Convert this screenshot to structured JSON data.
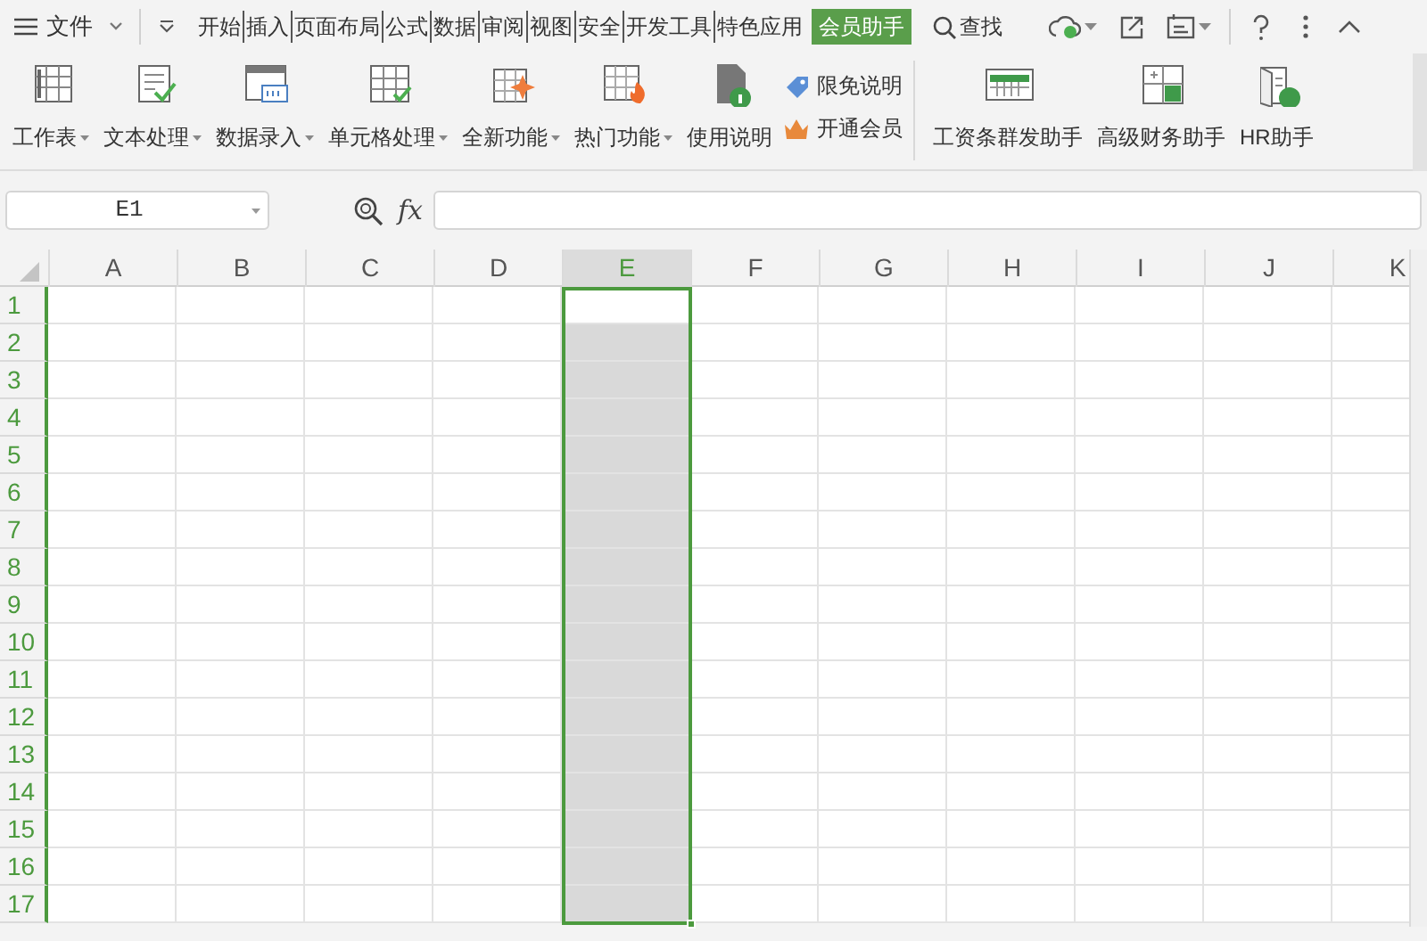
{
  "menu": {
    "file_label": "文件"
  },
  "tabs": [
    {
      "label": "开始",
      "selected": false
    },
    {
      "label": "插入",
      "selected": false
    },
    {
      "label": "页面布局",
      "selected": false
    },
    {
      "label": "公式",
      "selected": false
    },
    {
      "label": "数据",
      "selected": false
    },
    {
      "label": "审阅",
      "selected": false
    },
    {
      "label": "视图",
      "selected": false
    },
    {
      "label": "安全",
      "selected": false
    },
    {
      "label": "开发工具",
      "selected": false
    },
    {
      "label": "特色应用",
      "selected": false
    },
    {
      "label": "会员助手",
      "selected": true
    }
  ],
  "search": {
    "label": "查找"
  },
  "ribbon": [
    {
      "kind": "large",
      "label": "工作表",
      "dropdown": true
    },
    {
      "kind": "large",
      "label": "文本处理",
      "dropdown": true
    },
    {
      "kind": "large",
      "label": "数据录入",
      "dropdown": true
    },
    {
      "kind": "large",
      "label": "单元格处理",
      "dropdown": true
    },
    {
      "kind": "large",
      "label": "全新功能",
      "dropdown": true
    },
    {
      "kind": "large",
      "label": "热门功能",
      "dropdown": true
    },
    {
      "kind": "large",
      "label": "使用说明",
      "dropdown": false
    },
    {
      "kind": "small",
      "items": [
        {
          "label": "限免说明"
        },
        {
          "label": "开通会员"
        }
      ]
    },
    {
      "kind": "separator"
    },
    {
      "kind": "large",
      "label": "工资条群发助手",
      "dropdown": false
    },
    {
      "kind": "large",
      "label": "高级财务助手",
      "dropdown": false
    },
    {
      "kind": "large",
      "label": "HR助手",
      "dropdown": false
    }
  ],
  "name_box": {
    "value": "E1"
  },
  "formula_bar": {
    "fx_label": "fx"
  },
  "grid": {
    "columns": [
      {
        "label": "A",
        "selected": false
      },
      {
        "label": "B",
        "selected": false
      },
      {
        "label": "C",
        "selected": false
      },
      {
        "label": "D",
        "selected": false
      },
      {
        "label": "E",
        "selected": true
      },
      {
        "label": "F",
        "selected": false
      },
      {
        "label": "G",
        "selected": false
      },
      {
        "label": "H",
        "selected": false
      },
      {
        "label": "I",
        "selected": false
      },
      {
        "label": "J",
        "selected": false
      },
      {
        "label": "K",
        "selected": false
      }
    ],
    "rows": [
      {
        "label": "1",
        "selected": true
      },
      {
        "label": "2",
        "selected": true
      },
      {
        "label": "3",
        "selected": true
      },
      {
        "label": "4",
        "selected": true
      },
      {
        "label": "5",
        "selected": true
      },
      {
        "label": "6",
        "selected": true
      },
      {
        "label": "7",
        "selected": true
      },
      {
        "label": "8",
        "selected": true
      },
      {
        "label": "9",
        "selected": true
      },
      {
        "label": "10",
        "selected": true
      },
      {
        "label": "11",
        "selected": true
      },
      {
        "label": "12",
        "selected": true
      },
      {
        "label": "13",
        "selected": true
      },
      {
        "label": "14",
        "selected": true
      },
      {
        "label": "15",
        "selected": true
      },
      {
        "label": "16",
        "selected": true
      },
      {
        "label": "17",
        "selected": true
      }
    ]
  }
}
